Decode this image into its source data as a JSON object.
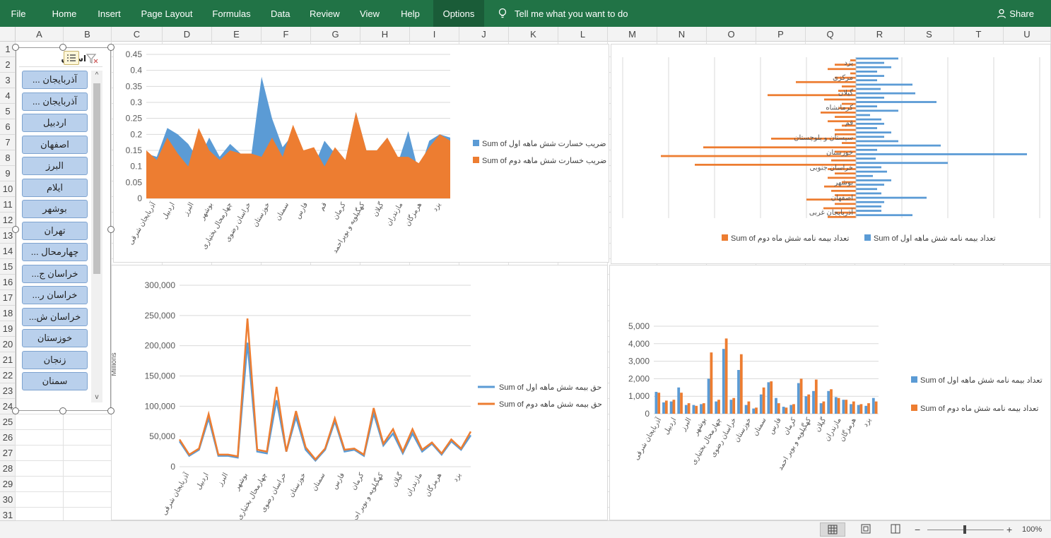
{
  "ribbon": {
    "tabs": [
      "File",
      "Home",
      "Insert",
      "Page Layout",
      "Formulas",
      "Data",
      "Review",
      "View",
      "Help",
      "Options"
    ],
    "active_tab": "Options",
    "tell_me": "Tell me what you want to do",
    "share": "Share"
  },
  "columns": [
    "A",
    "B",
    "C",
    "D",
    "E",
    "F",
    "G",
    "H",
    "I",
    "J",
    "K",
    "L",
    "M",
    "N",
    "O",
    "P",
    "Q",
    "R",
    "S",
    "T",
    "U"
  ],
  "rows": [
    "1",
    "2",
    "3",
    "4",
    "5",
    "6",
    "7",
    "8",
    "9",
    "10",
    "11",
    "12",
    "13",
    "14",
    "15",
    "16",
    "17",
    "18",
    "19",
    "20",
    "21",
    "22",
    "23",
    "24",
    "25",
    "26",
    "27",
    "28",
    "29",
    "30",
    "31"
  ],
  "slicer": {
    "title": "استان",
    "items": [
      "آذربایجان ...",
      "آذربایجان ...",
      "اردبیل",
      "اصفهان",
      "البرز",
      "ایلام",
      "بوشهر",
      "تهران",
      "چهارمحال ...",
      "خراسان ج...",
      "خراسان ر...",
      "خراسان ش...",
      "خوزستان",
      "زنجان",
      "سمنان"
    ]
  },
  "status": {
    "zoom": "100%"
  },
  "colors": {
    "blue": "#5b9bd5",
    "orange": "#ed7d31",
    "ribbon": "#217346"
  },
  "chart_data": [
    {
      "type": "area",
      "ylim": [
        0,
        0.45
      ],
      "yticks": [
        "0",
        "0.05",
        "0.1",
        "0.15",
        "0.2",
        "0.25",
        "0.3",
        "0.35",
        "0.4",
        "0.45"
      ],
      "categories": [
        "آذربایجان شرقی",
        "اردبیل",
        "البرز",
        "بوشهر",
        "چهارمحال بختیاری",
        "خراسان رضوی",
        "خوزستان",
        "سمنان",
        "فارس",
        "قم",
        "کرمان",
        "کهگیلویه و بویراحمد",
        "گیلان",
        "مازندران",
        "هرمزگان",
        "یزد"
      ],
      "series": [
        {
          "name": "Sum of ضریب خسارت شش ماهه اول",
          "values": [
            0.14,
            0.13,
            0.22,
            0.2,
            0.17,
            0.12,
            0.19,
            0.13,
            0.17,
            0.14,
            0.13,
            0.38,
            0.25,
            0.16,
            0.2,
            0.15,
            0.1,
            0.18,
            0.14,
            0.12,
            0.27,
            0.15,
            0.15,
            0.19,
            0.11,
            0.21,
            0.08,
            0.18,
            0.2,
            0.19
          ]
        },
        {
          "name": "Sum of ضریب خسارت شش ماهه دوم",
          "values": [
            0.15,
            0.12,
            0.19,
            0.14,
            0.1,
            0.22,
            0.15,
            0.12,
            0.15,
            0.14,
            0.14,
            0.13,
            0.19,
            0.13,
            0.23,
            0.15,
            0.16,
            0.1,
            0.16,
            0.12,
            0.27,
            0.15,
            0.15,
            0.19,
            0.13,
            0.13,
            0.11,
            0.16,
            0.2,
            0.18
          ]
        }
      ]
    },
    {
      "type": "bar",
      "orientation": "horizontal",
      "category_labels": [
        "یزد",
        "مرکزی",
        "گیلان",
        "کرمانشاه",
        "قم",
        "سیستان و بلوچستان",
        "خوزستان",
        "خراسان جنوبی",
        "بوشهر",
        "اصفهان",
        "آذربایجان غربی"
      ],
      "series": [
        {
          "name": "Sum of تعداد بیمه نامه شش ماهه اول"
        },
        {
          "name": "Sum of تعداد بیمه نامه شش ماه دوم"
        }
      ]
    },
    {
      "type": "line",
      "ylim": [
        0,
        300000
      ],
      "yticks": [
        "0",
        "50,000",
        "100,000",
        "150,000",
        "200,000",
        "250,000",
        "300,000"
      ],
      "ylabel": "Millions",
      "categories": [
        "آذربایجان شرقی",
        "اردبیل",
        "البرز",
        "بوشهر",
        "چهارمحال بختیاری",
        "خراسان رضوی",
        "خوزستان",
        "سمنان",
        "فارس",
        "کرمان",
        "کهگیلویه و بویر احمد",
        "گیلان",
        "مازندران",
        "هرمزگان",
        "یزد"
      ],
      "series": [
        {
          "name": "Sum of حق بیمه شش ماهه اول",
          "values": [
            42000,
            18000,
            28000,
            80000,
            18000,
            18000,
            15000,
            205000,
            25000,
            22000,
            110000,
            25000,
            82000,
            28000,
            10000,
            28000,
            75000,
            25000,
            28000,
            18000,
            88000,
            35000,
            55000,
            22000,
            55000,
            25000,
            38000,
            20000,
            42000,
            28000,
            52000
          ]
        },
        {
          "name": "Sum of حق بیمه شش ماهه دوم",
          "values": [
            45000,
            20000,
            30000,
            87000,
            20000,
            20000,
            17000,
            245000,
            28000,
            25000,
            132000,
            25000,
            92000,
            32000,
            12000,
            30000,
            80000,
            28000,
            30000,
            20000,
            97000,
            38000,
            62000,
            25000,
            62000,
            28000,
            40000,
            22000,
            45000,
            30000,
            58000
          ]
        }
      ]
    },
    {
      "type": "bar",
      "ylim": [
        0,
        5000
      ],
      "yticks": [
        "0",
        "1,000",
        "2,000",
        "3,000",
        "4,000",
        "5,000"
      ],
      "categories": [
        "آذربایجان شرقی",
        "اردبیل",
        "البرز",
        "بوشهر",
        "چهارمحال بختیاری",
        "خراسان رضوی",
        "خوزستان",
        "سمنان",
        "فارس",
        "کرمان",
        "کهگیلویه و بویر احمد",
        "گیلان",
        "مازندران",
        "هرمزگان",
        "یزد"
      ],
      "series": [
        {
          "name": "Sum of تعداد بیمه نامه شش ماهه اول",
          "values": [
            1250,
            650,
            700,
            1500,
            500,
            500,
            550,
            2000,
            700,
            3700,
            800,
            2500,
            500,
            300,
            1100,
            1800,
            900,
            400,
            500,
            1750,
            1000,
            1300,
            600,
            1300,
            950,
            800,
            550,
            500,
            450,
            900
          ]
        },
        {
          "name": "Sum of تعداد بیمه نامه شش ماه دوم",
          "values": [
            1200,
            750,
            800,
            1200,
            600,
            450,
            600,
            3500,
            800,
            4300,
            900,
            3400,
            700,
            350,
            1500,
            1850,
            600,
            350,
            550,
            2000,
            1100,
            1950,
            700,
            1400,
            900,
            800,
            700,
            550,
            600,
            700
          ]
        }
      ]
    }
  ]
}
